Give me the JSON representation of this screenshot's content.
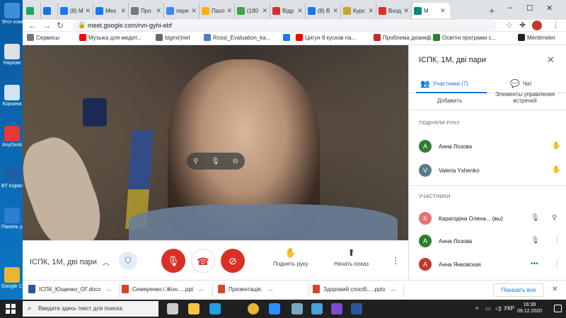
{
  "desktop": {
    "icons": [
      {
        "label": "Этот компьютер",
        "color": "#3a8fd8"
      },
      {
        "label": "Наукові",
        "color": "#e0e0e0"
      },
      {
        "label": "Корзина",
        "color": "#d0e4f4"
      },
      {
        "label": "AnyDesk",
        "color": "#e53935"
      },
      {
        "label": "BT Користу...",
        "color": "#1e5fa8"
      },
      {
        "label": "Панель управле...",
        "color": "#2d7fd3"
      },
      {
        "label": "Google Chrome",
        "color": "#e8b634"
      }
    ]
  },
  "browser": {
    "tabs": [
      {
        "label": "",
        "icon": "meet-icon",
        "color": "#1fa463"
      },
      {
        "label": "",
        "icon": "app-icon",
        "color": "#1a73e8"
      },
      {
        "label": "(8) M",
        "icon": "facebook-icon",
        "color": "#1877f2"
      },
      {
        "label": "Mes",
        "icon": "facebook-icon",
        "color": "#1877f2"
      },
      {
        "label": "Про",
        "icon": "doc-icon",
        "color": "#777777"
      },
      {
        "label": "пере",
        "icon": "google-icon",
        "color": "#4285f4"
      },
      {
        "label": "Пазл",
        "icon": "puzzle-icon",
        "color": "#f4b400"
      },
      {
        "label": "(180",
        "icon": "mail-icon",
        "color": "#43a047"
      },
      {
        "label": "Відр",
        "icon": "opera-icon",
        "color": "#d32f2f"
      },
      {
        "label": "(8) B",
        "icon": "facebook-icon",
        "color": "#1877f2"
      },
      {
        "label": "Курс",
        "icon": "course-icon",
        "color": "#c9a227"
      },
      {
        "label": "Вход",
        "icon": "gmail-icon",
        "color": "#d93025"
      },
      {
        "label": "М",
        "icon": "meet-icon",
        "color": "#00897b",
        "active": true
      }
    ],
    "new_tab": "+",
    "window_controls": {
      "minimize": "–",
      "maximize": "☐",
      "close": "✕"
    },
    "url": "meet.google.com/rvn-gyhi-ebf",
    "profile_initial": "",
    "bookmarks": [
      {
        "label": "Сервисы",
        "color": "#777777"
      },
      {
        "label": "Музыка для медит...",
        "color": "#ff0000"
      },
      {
        "label": "bigmir)net",
        "color": "#666666"
      },
      {
        "label": "Rossi_Evaluation_ka...",
        "color": "#4a7bd0"
      },
      {
        "label": "",
        "color": "#1877f2"
      },
      {
        "label": "Цигун 8 кусков па...",
        "color": "#ff0000"
      },
      {
        "label": "Проблема дезинф...",
        "color": "#c62828"
      },
      {
        "label": "Освітні програми с...",
        "color": "#2e7d32"
      },
      {
        "label": "Mentimeter",
        "color": "#222222"
      }
    ]
  },
  "meet": {
    "meeting_title": "ІСПК, 1М, дві пари",
    "video_controls": [
      "pin",
      "mic",
      "remove"
    ],
    "actions": {
      "raise_hand": "Поднять руку",
      "present": "Начать показ"
    },
    "panel": {
      "title": "ІСПК, 1М, дві пари",
      "tabs": {
        "participants": "Участники (7)",
        "chat": "Чат"
      },
      "add_label": "Добавить",
      "controls_label": "Элементы управления встречей",
      "raised_section": "ПОДНЯЛИ РУКУ",
      "raised": [
        {
          "name": "Анна Лозова",
          "initial": "А",
          "color": "#2e7d32"
        },
        {
          "name": "Valeria Yshenko",
          "initial": "V",
          "color": "#5b7a8c"
        }
      ],
      "participants_section": "УЧАСТНИКИ",
      "participants": [
        {
          "name": "Карагодіна Олена... (вы)",
          "initial": "К",
          "color": "#e57373"
        },
        {
          "name": "Анна Лозова",
          "initial": "А",
          "color": "#2e7d32"
        },
        {
          "name": "Анна Янковская",
          "initial": "А",
          "color": "#c0392b"
        }
      ]
    }
  },
  "downloads": {
    "items": [
      {
        "name": "ІСПК_Ющенко_ОГ.docx",
        "color": "#2b579a"
      },
      {
        "name": "Семеренко і Жон.....ppt",
        "color": "#d24726"
      },
      {
        "name": "Презентація.",
        "color": "#d24726"
      },
      {
        "name": "Здоровий спосіб.....pptx",
        "color": "#d24726"
      }
    ],
    "show_all": "Показать все"
  },
  "taskbar": {
    "search_placeholder": "Введите здесь текст для поиска",
    "apps": [
      {
        "icon": "task-view-icon",
        "color": "#cccccc"
      },
      {
        "icon": "explorer-icon",
        "color": "#f4c542"
      },
      {
        "icon": "edge-icon",
        "color": "#1fa0e0"
      },
      {
        "icon": "chrome-icon",
        "color": "#e8b634"
      },
      {
        "icon": "zoom-icon",
        "color": "#2d8cff"
      },
      {
        "icon": "image-icon",
        "color": "#7aa6c8"
      },
      {
        "icon": "app-icon",
        "color": "#4aa0d8"
      },
      {
        "icon": "viber-icon",
        "color": "#7c4dcc"
      },
      {
        "icon": "word-icon",
        "color": "#2b579a"
      }
    ],
    "tray_lang": "УКР",
    "time": "16:39",
    "date": "09.12.2020"
  }
}
